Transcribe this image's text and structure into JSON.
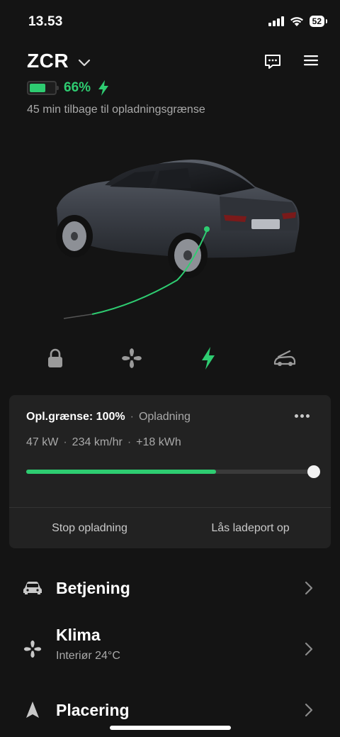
{
  "status_bar": {
    "time": "13.53",
    "battery_level": "52",
    "icons": [
      "cellular-signal-icon",
      "wifi-icon",
      "battery-icon"
    ]
  },
  "header": {
    "vehicle_name": "ZCR",
    "actions": [
      "messages-icon",
      "menu-icon"
    ]
  },
  "battery": {
    "percent_text": "66%",
    "level_fraction": 0.66,
    "charging": true,
    "time_to_limit": "45 min tilbage til opladningsgrænse"
  },
  "quick_actions": [
    "lock-icon",
    "fan-icon",
    "charging-bolt-icon",
    "trunk-icon"
  ],
  "charge_card": {
    "limit_label": "Opl.grænse: 100%",
    "state": "Opladning",
    "power": "47 kW",
    "rate": "234 km/hr",
    "energy_added": "+18 kWh",
    "progress_fraction": 0.66,
    "limit_fraction": 1.0,
    "stop_button": "Stop opladning",
    "unlock_port_button": "Lås ladeport op"
  },
  "menu": [
    {
      "id": "controls",
      "title": "Betjening",
      "subtitle": "",
      "icon": "car-icon"
    },
    {
      "id": "climate",
      "title": "Klima",
      "subtitle": "Interiør 24°C",
      "icon": "fan-icon"
    },
    {
      "id": "location",
      "title": "Placering",
      "subtitle": "",
      "icon": "location-arrow-icon"
    }
  ],
  "colors": {
    "background": "#141414",
    "card": "#222222",
    "accent_green": "#2ecc71",
    "muted_text": "#a9a9a9"
  }
}
